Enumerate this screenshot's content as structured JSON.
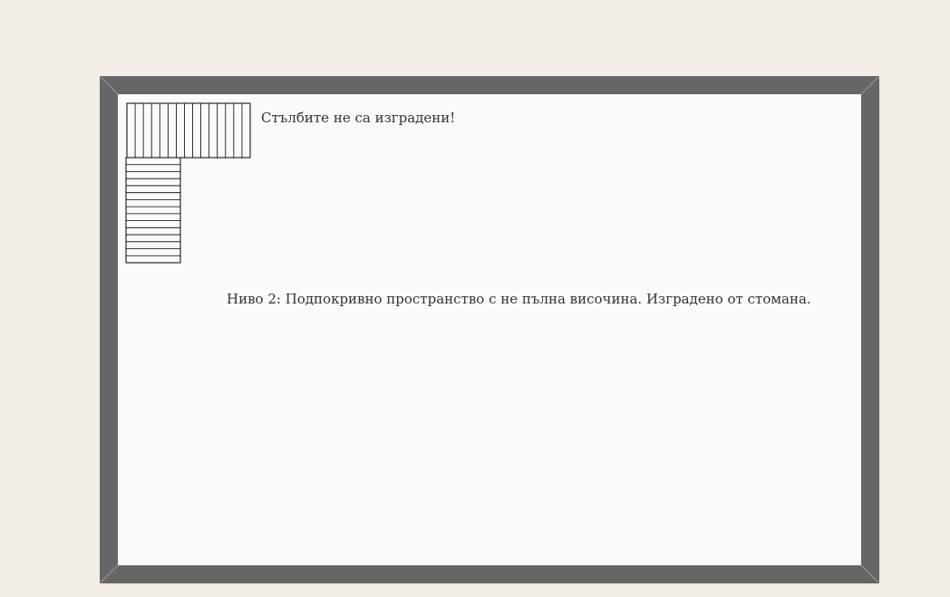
{
  "floor_plan": {
    "stairs_note": "Стълбите не са изградени!",
    "level_note": "Ниво 2: Подпокривно пространство с не пълна височина. Изградено от стомана."
  },
  "colors": {
    "page_background": "#f2ede6",
    "wall": "#666666",
    "floor": "#fafafa",
    "wall_corner_line": "#9a9a9a",
    "stair_line": "#000000",
    "text": "#333333"
  },
  "stairs": {
    "upper_flight_treads": 15,
    "lower_flight_treads": 15
  }
}
